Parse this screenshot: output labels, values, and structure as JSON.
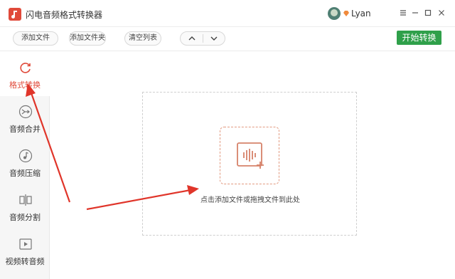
{
  "window": {
    "title": "闪电音频格式转换器",
    "user": "Lyan",
    "controls": [
      "menu-icon",
      "minimize-icon",
      "maximize-icon",
      "close-icon"
    ]
  },
  "toolbar": {
    "add_file": "添加文件",
    "add_folder": "添加文件夹",
    "clear_list": "清空列表",
    "start": "开始转换"
  },
  "sidebar": {
    "items": [
      {
        "label": "格式转换",
        "icon": "refresh-icon",
        "active": true
      },
      {
        "label": "音频合并",
        "icon": "merge-icon",
        "active": false
      },
      {
        "label": "音频压缩",
        "icon": "music-note-icon",
        "active": false
      },
      {
        "label": "音频分割",
        "icon": "split-icon",
        "active": false
      },
      {
        "label": "视频转音频",
        "icon": "video-play-icon",
        "active": false
      }
    ]
  },
  "main": {
    "drop_hint": "点击添加文件或拖拽文件到此处"
  },
  "colors": {
    "accent": "#e04a3a",
    "start_button": "#2fa04a",
    "dropzone_accent": "#e29a80"
  }
}
